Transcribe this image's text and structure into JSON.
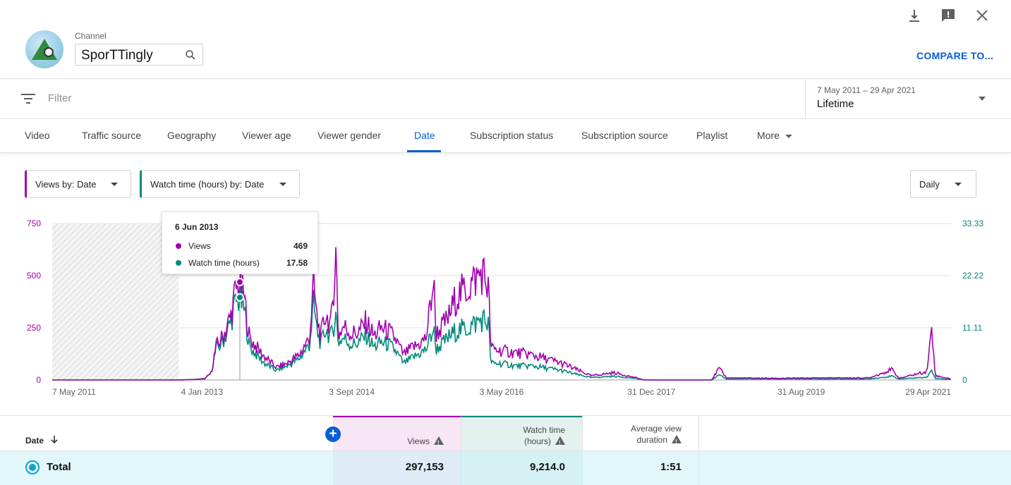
{
  "header": {
    "channel_label": "Channel",
    "channel_name": "SporTTingly",
    "compare_label": "COMPARE TO..."
  },
  "filter": {
    "placeholder": "Filter",
    "date_range": "7 May 2011 – 29 Apr 2021",
    "range_label": "Lifetime"
  },
  "tabs": [
    {
      "label": "Video",
      "active": false
    },
    {
      "label": "Traffic source",
      "active": false
    },
    {
      "label": "Geography",
      "active": false
    },
    {
      "label": "Viewer age",
      "active": false
    },
    {
      "label": "Viewer gender",
      "active": false
    },
    {
      "label": "Date",
      "active": true
    },
    {
      "label": "Subscription status",
      "active": false
    },
    {
      "label": "Subscription source",
      "active": false
    },
    {
      "label": "Playlist",
      "active": false
    },
    {
      "label": "More",
      "active": false
    }
  ],
  "metric_selectors": {
    "primary": "Views by: Date",
    "secondary": "Watch time (hours) by: Date",
    "granularity": "Daily"
  },
  "colors": {
    "views": "#a100ae",
    "watch_time": "#00897b",
    "accent": "#065fd4"
  },
  "tooltip": {
    "date": "6 Jun 2013",
    "rows": [
      {
        "name": "Views",
        "value": "469"
      },
      {
        "name": "Watch time (hours)",
        "value": "17.58"
      }
    ]
  },
  "chart_data": {
    "type": "line",
    "x_tick_labels": [
      "7 May 2011",
      "4 Jan 2013",
      "3 Sept 2014",
      "3 May 2016",
      "31 Dec 2017",
      "31 Aug 2019",
      "29 Apr 2021"
    ],
    "y_left": {
      "ticks": [
        "0",
        "250",
        "500",
        "750"
      ],
      "range": [
        0,
        750
      ]
    },
    "y_right": {
      "ticks": [
        "0",
        "11.11",
        "22.22",
        "33.33"
      ],
      "range": [
        0,
        33.33
      ]
    },
    "x_range": [
      "2011-05-07",
      "2021-04-29"
    ],
    "no_data_until": "2012-10-01",
    "series": [
      {
        "name": "Views",
        "axis": "left",
        "points": [
          [
            "2011-05-07",
            0
          ],
          [
            "2012-10-01",
            0
          ],
          [
            "2012-12-01",
            2
          ],
          [
            "2013-01-15",
            5
          ],
          [
            "2013-02-10",
            35
          ],
          [
            "2013-03-01",
            160
          ],
          [
            "2013-03-20",
            190
          ],
          [
            "2013-04-10",
            240
          ],
          [
            "2013-05-01",
            310
          ],
          [
            "2013-05-20",
            430
          ],
          [
            "2013-06-06",
            469
          ],
          [
            "2013-06-25",
            380
          ],
          [
            "2013-07-15",
            200
          ],
          [
            "2013-08-10",
            160
          ],
          [
            "2013-09-15",
            110
          ],
          [
            "2013-11-01",
            60
          ],
          [
            "2013-12-15",
            80
          ],
          [
            "2014-02-01",
            120
          ],
          [
            "2014-03-15",
            200
          ],
          [
            "2014-04-01",
            460
          ],
          [
            "2014-04-15",
            290
          ],
          [
            "2014-05-01",
            210
          ],
          [
            "2014-05-20",
            320
          ],
          [
            "2014-06-10",
            250
          ],
          [
            "2014-07-01",
            620
          ],
          [
            "2014-07-10",
            210
          ],
          [
            "2014-08-01",
            260
          ],
          [
            "2014-09-01",
            220
          ],
          [
            "2014-10-01",
            230
          ],
          [
            "2014-11-01",
            280
          ],
          [
            "2014-12-01",
            210
          ],
          [
            "2015-01-01",
            250
          ],
          [
            "2015-02-01",
            230
          ],
          [
            "2015-03-01",
            190
          ],
          [
            "2015-04-01",
            120
          ],
          [
            "2015-05-01",
            150
          ],
          [
            "2015-06-01",
            170
          ],
          [
            "2015-07-01",
            200
          ],
          [
            "2015-08-01",
            480
          ],
          [
            "2015-08-10",
            220
          ],
          [
            "2015-09-01",
            250
          ],
          [
            "2015-10-01",
            300
          ],
          [
            "2015-11-01",
            400
          ],
          [
            "2015-12-15",
            440
          ],
          [
            "2016-01-15",
            480
          ],
          [
            "2016-02-15",
            520
          ],
          [
            "2016-03-10",
            440
          ],
          [
            "2016-03-20",
            150
          ],
          [
            "2016-05-01",
            140
          ],
          [
            "2016-07-01",
            130
          ],
          [
            "2016-09-01",
            120
          ],
          [
            "2016-11-01",
            100
          ],
          [
            "2017-01-01",
            80
          ],
          [
            "2017-03-01",
            50
          ],
          [
            "2017-05-01",
            20
          ],
          [
            "2017-08-01",
            35
          ],
          [
            "2017-11-01",
            10
          ],
          [
            "2017-12-01",
            0
          ],
          [
            "2018-09-01",
            0
          ],
          [
            "2018-10-01",
            55
          ],
          [
            "2018-11-01",
            10
          ],
          [
            "2019-06-01",
            8
          ],
          [
            "2019-12-01",
            10
          ],
          [
            "2020-06-01",
            10
          ],
          [
            "2020-09-01",
            50
          ],
          [
            "2020-10-01",
            8
          ],
          [
            "2021-01-20",
            40
          ],
          [
            "2021-02-10",
            240
          ],
          [
            "2021-02-25",
            20
          ],
          [
            "2021-04-29",
            5
          ]
        ]
      },
      {
        "name": "Watch time (hours)",
        "axis": "right",
        "points": [
          [
            "2011-05-07",
            0
          ],
          [
            "2012-10-01",
            0
          ],
          [
            "2012-12-01",
            0.1
          ],
          [
            "2013-01-15",
            0.3
          ],
          [
            "2013-02-10",
            1.5
          ],
          [
            "2013-03-01",
            6.5
          ],
          [
            "2013-03-20",
            7.5
          ],
          [
            "2013-04-10",
            9.5
          ],
          [
            "2013-05-01",
            12.5
          ],
          [
            "2013-05-20",
            16.5
          ],
          [
            "2013-06-06",
            17.58
          ],
          [
            "2013-06-25",
            14.5
          ],
          [
            "2013-07-15",
            7
          ],
          [
            "2013-08-10",
            5.5
          ],
          [
            "2013-09-15",
            3.5
          ],
          [
            "2013-11-01",
            2
          ],
          [
            "2013-12-15",
            3
          ],
          [
            "2014-02-01",
            4.5
          ],
          [
            "2014-03-15",
            7.5
          ],
          [
            "2014-04-01",
            16
          ],
          [
            "2014-04-15",
            10.5
          ],
          [
            "2014-05-01",
            7.5
          ],
          [
            "2014-05-20",
            11
          ],
          [
            "2014-06-10",
            9
          ],
          [
            "2014-07-01",
            14
          ],
          [
            "2014-07-10",
            8
          ],
          [
            "2014-08-01",
            9
          ],
          [
            "2014-09-01",
            7.5
          ],
          [
            "2014-10-01",
            8
          ],
          [
            "2014-11-01",
            9.5
          ],
          [
            "2014-12-01",
            7
          ],
          [
            "2015-01-01",
            8
          ],
          [
            "2015-02-01",
            7.5
          ],
          [
            "2015-03-01",
            6
          ],
          [
            "2015-04-01",
            3.5
          ],
          [
            "2015-05-01",
            4.5
          ],
          [
            "2015-06-01",
            5.5
          ],
          [
            "2015-07-01",
            6.5
          ],
          [
            "2015-08-01",
            11
          ],
          [
            "2015-08-10",
            6.5
          ],
          [
            "2015-09-01",
            7.5
          ],
          [
            "2015-10-01",
            9
          ],
          [
            "2015-11-01",
            10.5
          ],
          [
            "2015-12-15",
            11
          ],
          [
            "2016-01-15",
            12
          ],
          [
            "2016-02-15",
            13
          ],
          [
            "2016-03-10",
            12
          ],
          [
            "2016-03-20",
            3.5
          ],
          [
            "2016-05-01",
            3.5
          ],
          [
            "2016-07-01",
            3
          ],
          [
            "2016-09-01",
            3
          ],
          [
            "2016-11-01",
            2.5
          ],
          [
            "2017-01-01",
            2
          ],
          [
            "2017-03-01",
            1.2
          ],
          [
            "2017-05-01",
            0.5
          ],
          [
            "2017-08-01",
            0.8
          ],
          [
            "2017-11-01",
            0.3
          ],
          [
            "2017-12-01",
            0
          ],
          [
            "2018-09-01",
            0
          ],
          [
            "2018-10-01",
            1
          ],
          [
            "2018-11-01",
            0.2
          ],
          [
            "2019-06-01",
            0.2
          ],
          [
            "2019-12-01",
            0.2
          ],
          [
            "2020-06-01",
            0.2
          ],
          [
            "2020-09-01",
            0.8
          ],
          [
            "2020-10-01",
            0.2
          ],
          [
            "2021-01-20",
            0.6
          ],
          [
            "2021-02-10",
            2
          ],
          [
            "2021-02-25",
            0.3
          ],
          [
            "2021-04-29",
            0.1
          ]
        ]
      }
    ],
    "highlight": {
      "date": "2013-06-06"
    }
  },
  "table": {
    "date_header": "Date",
    "views_header": "Views",
    "watch_header_line1": "Watch time",
    "watch_header_line2": "(hours)",
    "avd_header_line1": "Average view",
    "avd_header_line2": "duration",
    "total_label": "Total",
    "total_views": "297,153",
    "total_watch": "9,214.0",
    "total_avd": "1:51"
  }
}
